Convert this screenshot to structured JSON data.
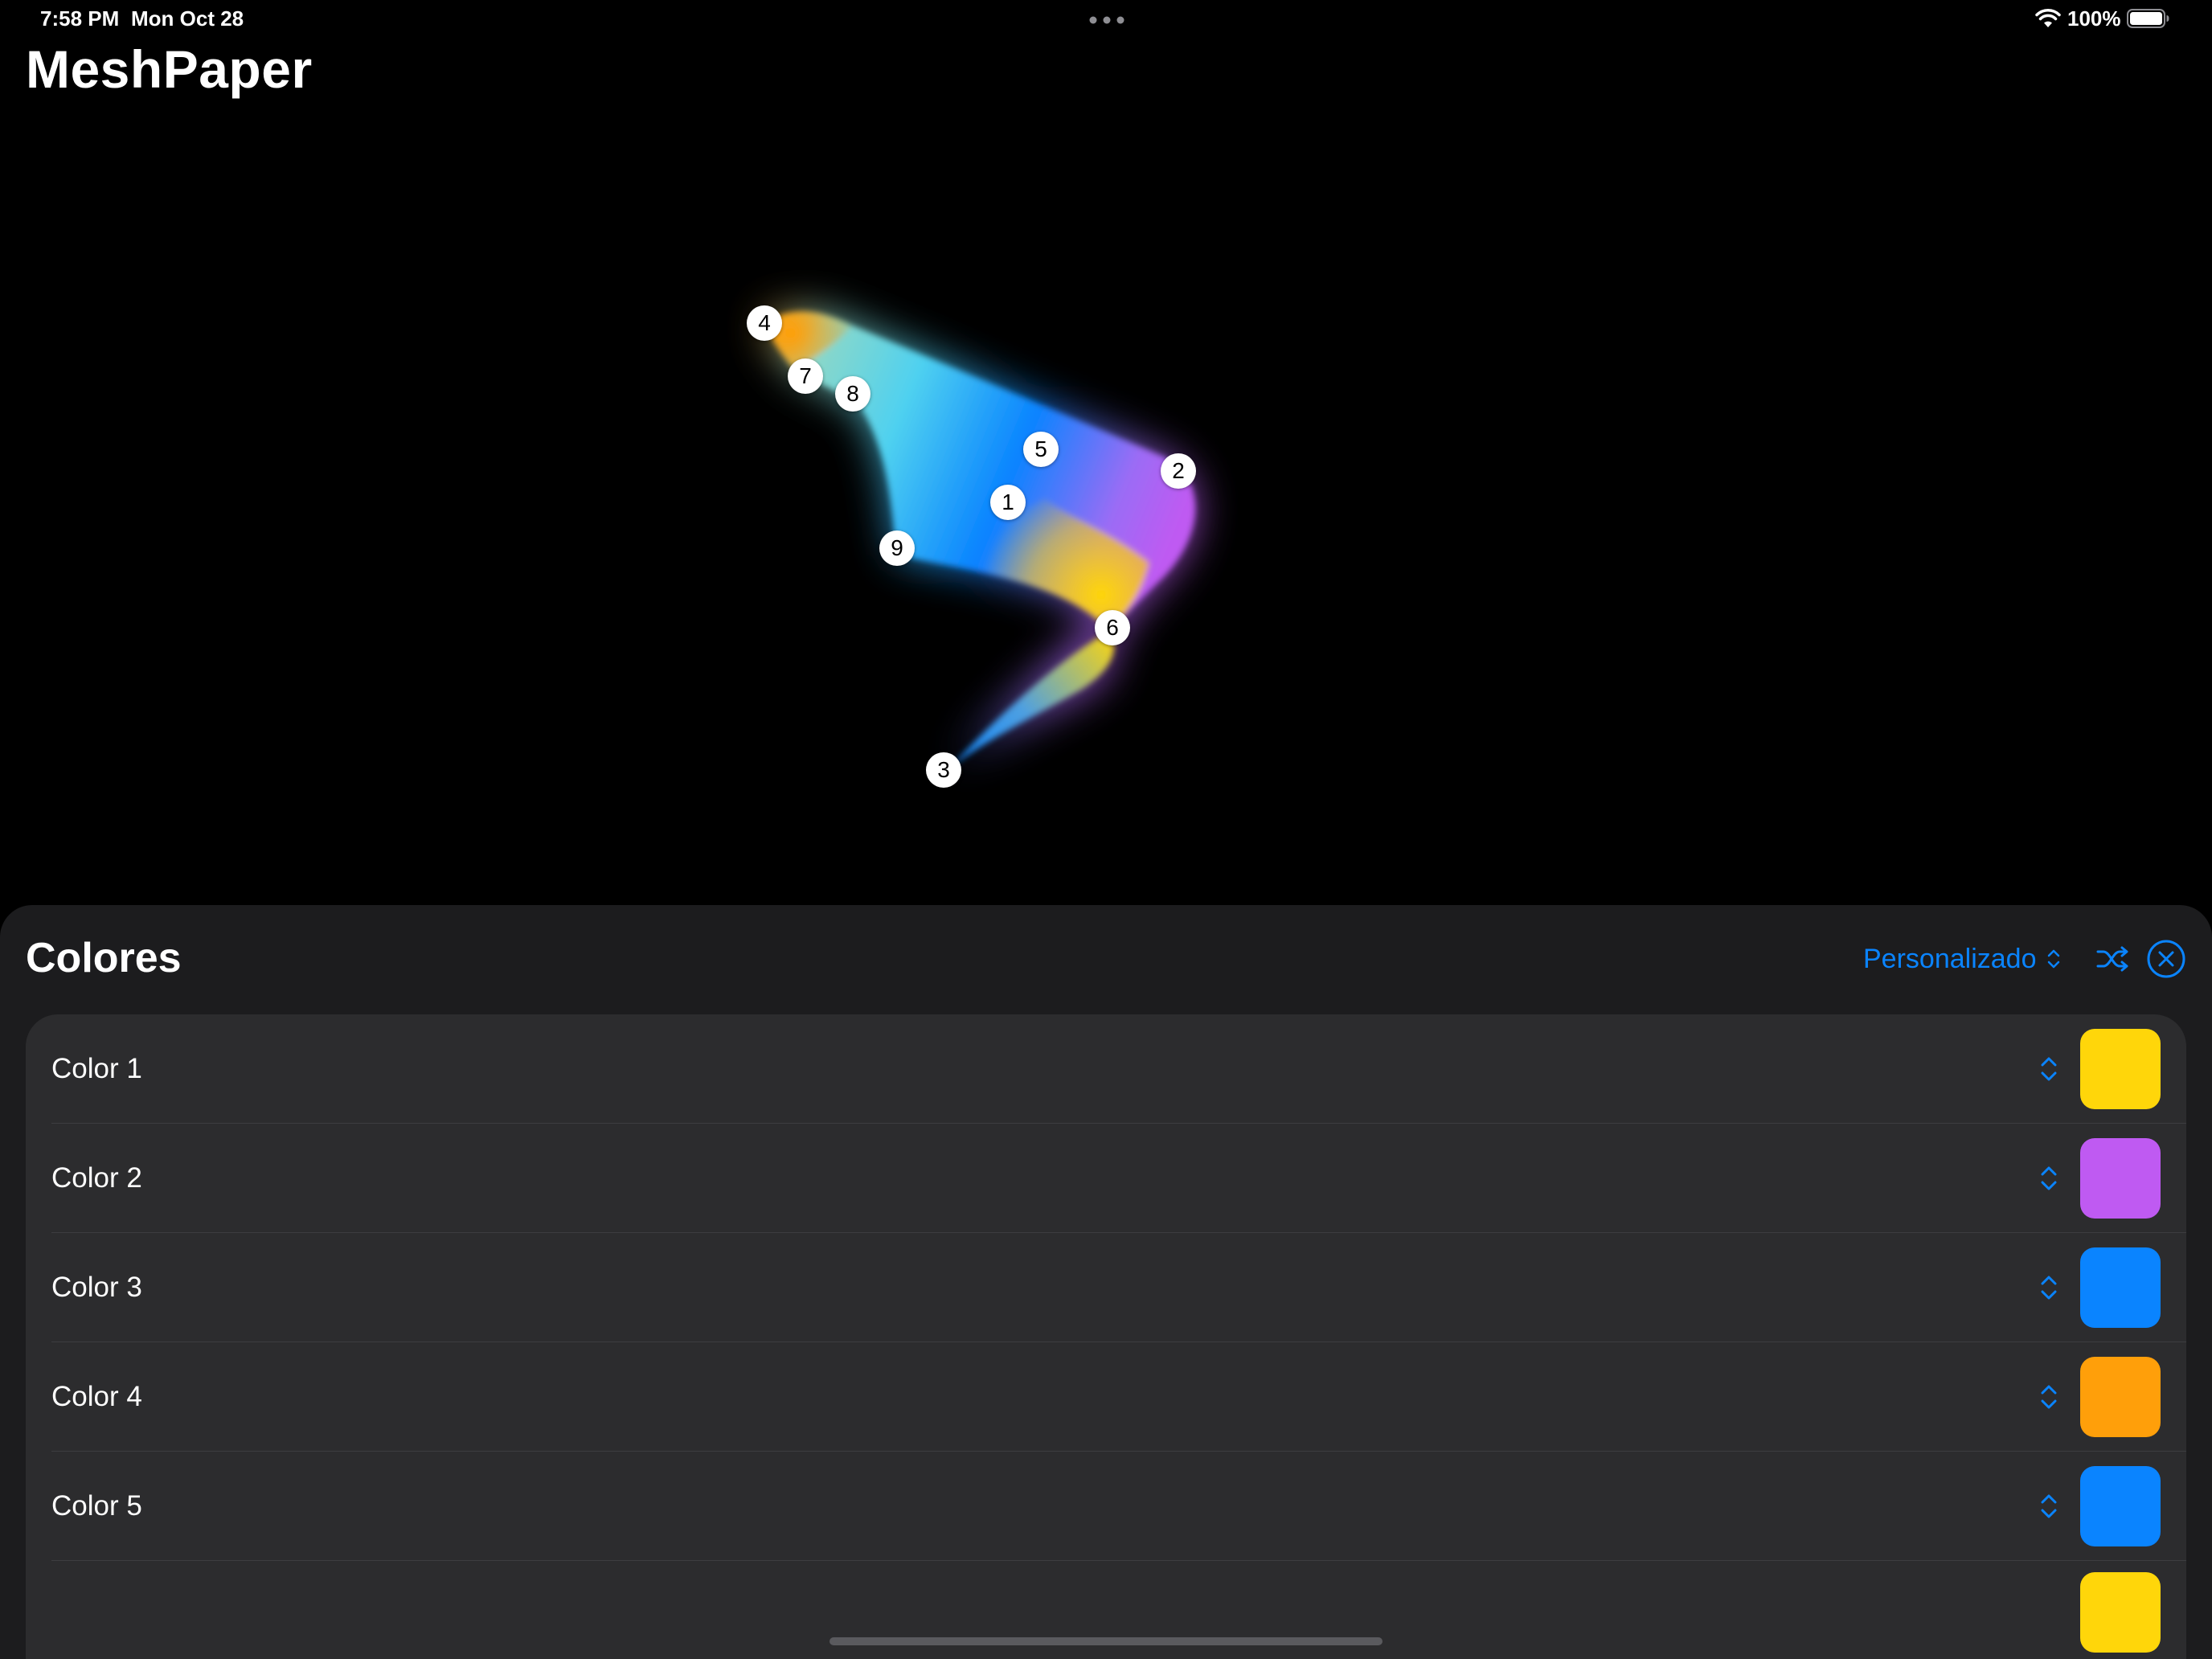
{
  "status_bar": {
    "time": "7:58 PM",
    "date": "Mon Oct 28",
    "battery": "100%",
    "icons": [
      "multitask-dots-icon",
      "wifi-icon",
      "battery-icon"
    ]
  },
  "app": {
    "title": "MeshPaper"
  },
  "mesh": {
    "handles": [
      "1",
      "2",
      "3",
      "4",
      "5",
      "6",
      "7",
      "8",
      "9"
    ],
    "gradient_colors": {
      "orange": "#ff9f0a",
      "cyan": "#5ac8fa",
      "blue": "#0a84ff",
      "purple": "#bf5af2",
      "yellow": "#ffd60a"
    }
  },
  "sheet": {
    "title": "Colores",
    "preset_label": "Personalizado",
    "shuffle_icon": "shuffle-icon",
    "close_icon": "close-circle-icon",
    "accent_color": "#0a84ff",
    "colors": [
      {
        "label": "Color 1",
        "swatch": "#ffd60a"
      },
      {
        "label": "Color 2",
        "swatch": "#bf5af2"
      },
      {
        "label": "Color 3",
        "swatch": "#0a84ff"
      },
      {
        "label": "Color 4",
        "swatch": "#ff9f0a"
      },
      {
        "label": "Color 5",
        "swatch": "#0a84ff"
      },
      {
        "label": "",
        "swatch": "#ffd60a"
      }
    ]
  }
}
